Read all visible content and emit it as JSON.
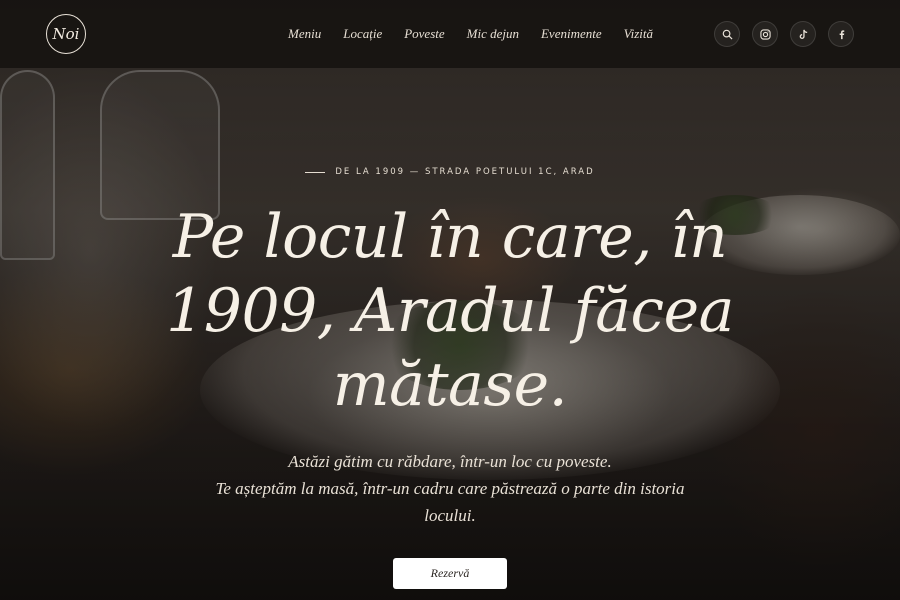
{
  "header": {
    "logo_text": "Noi",
    "nav": [
      "Meniu",
      "Locație",
      "Poveste",
      "Mic dejun",
      "Evenimente",
      "Vizită"
    ],
    "icons": [
      "search-icon",
      "instagram-icon",
      "tiktok-icon",
      "facebook-icon"
    ]
  },
  "hero": {
    "eyebrow": "DE LA 1909 — STRADA POETULUI 1C, ARAD",
    "headline": "Pe locul în care, în 1909, Aradul făcea mătase.",
    "lead_line1": "Astăzi gătim cu răbdare, într-un loc cu poveste.",
    "lead_line2": "Te așteptăm la masă, într-un cadru care păstrează o parte din istoria locului.",
    "cta_label": "Rezervă"
  },
  "colors": {
    "header_bg": "#14110f",
    "text": "#f3ece2",
    "button_bg": "#ffffff"
  }
}
